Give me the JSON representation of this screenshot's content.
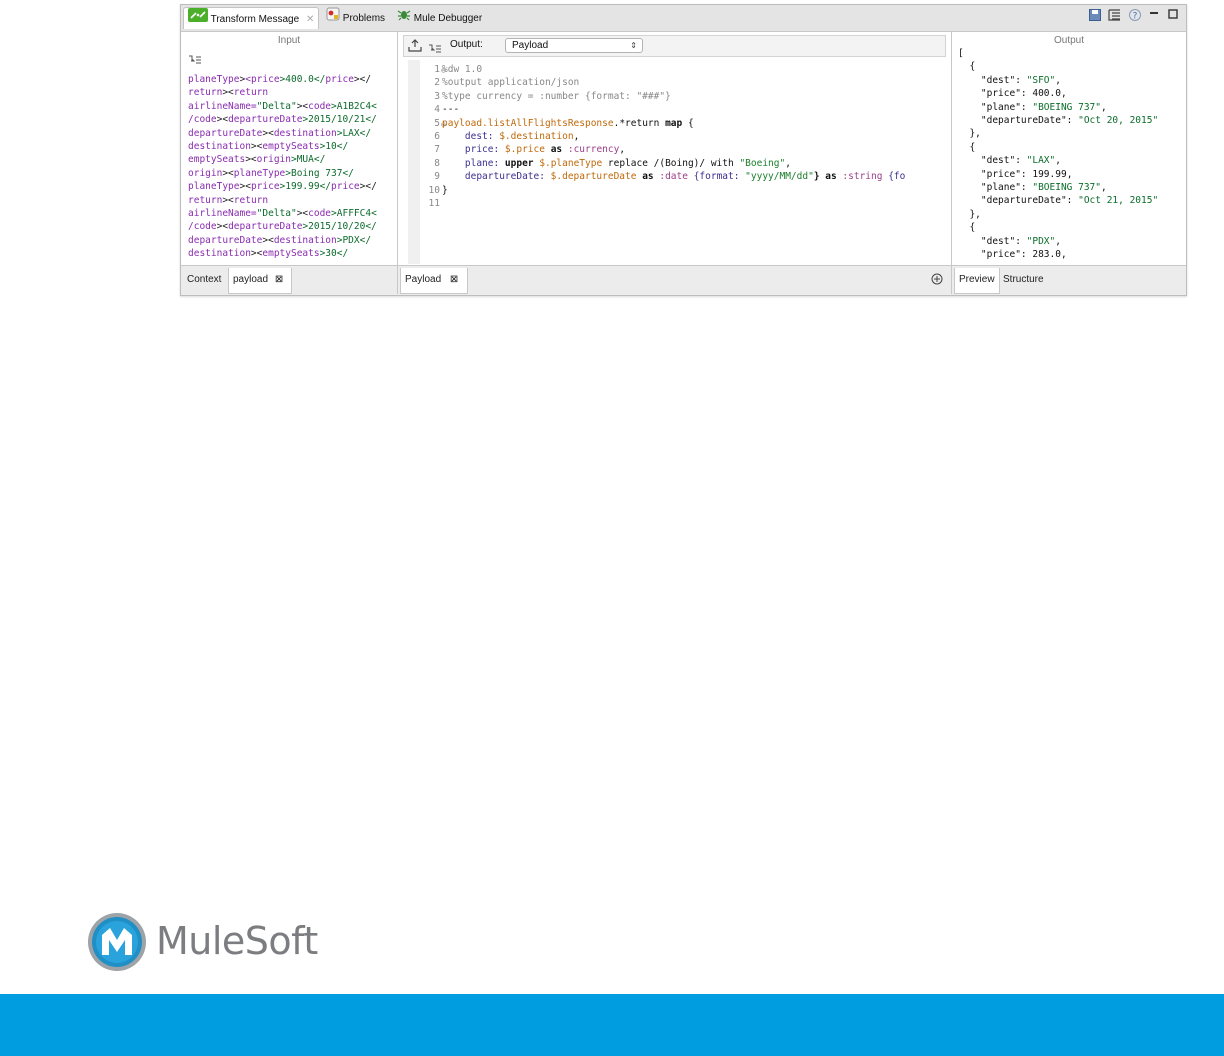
{
  "window_tabs": [
    {
      "label": "Transform Message",
      "icon": "transform-icon",
      "active": true
    },
    {
      "label": "Problems",
      "icon": "problems-icon",
      "active": false
    },
    {
      "label": "Mule Debugger",
      "icon": "debugger-icon",
      "active": false
    }
  ],
  "input_pane": {
    "title": "Input",
    "bottom_tabs": [
      "Context",
      "payload"
    ],
    "lines": [
      [
        {
          "t": "planeType",
          "c": "tg"
        },
        {
          "t": ">",
          "c": "ch"
        },
        {
          "t": "<price",
          "c": "tg"
        },
        {
          "t": ">400.0</",
          "c": "tx"
        },
        {
          "t": "price",
          "c": "tg"
        },
        {
          "t": "></",
          "c": "ch"
        }
      ],
      [
        {
          "t": "return",
          "c": "tg"
        },
        {
          "t": "><",
          "c": "ch"
        },
        {
          "t": "return",
          "c": "tg"
        }
      ],
      [
        {
          "t": "airlineName=",
          "c": "tg"
        },
        {
          "t": "\"Delta\"",
          "c": "tx"
        },
        {
          "t": "><",
          "c": "ch"
        },
        {
          "t": "code",
          "c": "tg"
        },
        {
          "t": ">A1B2C4<",
          "c": "tx"
        }
      ],
      [
        {
          "t": "/code",
          "c": "tg"
        },
        {
          "t": "><",
          "c": "ch"
        },
        {
          "t": "departureDate",
          "c": "tg"
        },
        {
          "t": ">2015/10/21</",
          "c": "tx"
        }
      ],
      [
        {
          "t": "departureDate",
          "c": "tg"
        },
        {
          "t": "><",
          "c": "ch"
        },
        {
          "t": "destination",
          "c": "tg"
        },
        {
          "t": ">LAX</",
          "c": "tx"
        }
      ],
      [
        {
          "t": "destination",
          "c": "tg"
        },
        {
          "t": "><",
          "c": "ch"
        },
        {
          "t": "emptySeats",
          "c": "tg"
        },
        {
          "t": ">10</",
          "c": "tx"
        }
      ],
      [
        {
          "t": "emptySeats",
          "c": "tg"
        },
        {
          "t": "><",
          "c": "ch"
        },
        {
          "t": "origin",
          "c": "tg"
        },
        {
          "t": ">MUA</",
          "c": "tx"
        }
      ],
      [
        {
          "t": "origin",
          "c": "tg"
        },
        {
          "t": "><",
          "c": "ch"
        },
        {
          "t": "planeType",
          "c": "tg"
        },
        {
          "t": ">Boing 737</",
          "c": "tx"
        }
      ],
      [
        {
          "t": "planeType",
          "c": "tg"
        },
        {
          "t": "><",
          "c": "ch"
        },
        {
          "t": "price",
          "c": "tg"
        },
        {
          "t": ">199.99</",
          "c": "tx"
        },
        {
          "t": "price",
          "c": "tg"
        },
        {
          "t": "></",
          "c": "ch"
        }
      ],
      [
        {
          "t": "return",
          "c": "tg"
        },
        {
          "t": "><",
          "c": "ch"
        },
        {
          "t": "return",
          "c": "tg"
        }
      ],
      [
        {
          "t": "airlineName=",
          "c": "tg"
        },
        {
          "t": "\"Delta\"",
          "c": "tx"
        },
        {
          "t": "><",
          "c": "ch"
        },
        {
          "t": "code",
          "c": "tg"
        },
        {
          "t": ">AFFFC4<",
          "c": "tx"
        }
      ],
      [
        {
          "t": "/code",
          "c": "tg"
        },
        {
          "t": "><",
          "c": "ch"
        },
        {
          "t": "departureDate",
          "c": "tg"
        },
        {
          "t": ">2015/10/20</",
          "c": "tx"
        }
      ],
      [
        {
          "t": "departureDate",
          "c": "tg"
        },
        {
          "t": "><",
          "c": "ch"
        },
        {
          "t": "destination",
          "c": "tg"
        },
        {
          "t": ">PDX</",
          "c": "tx"
        }
      ],
      [
        {
          "t": "destination",
          "c": "tg"
        },
        {
          "t": "><",
          "c": "ch"
        },
        {
          "t": "emptySeats",
          "c": "tg"
        },
        {
          "t": ">30</",
          "c": "tx"
        }
      ]
    ]
  },
  "script_pane": {
    "output_label": "Output:",
    "output_value": "Payload",
    "bottom_tab": "Payload",
    "lines": [
      {
        "n": "1",
        "fold": true,
        "parts": [
          {
            "t": "%dw 1.0",
            "c": "k-dir"
          }
        ]
      },
      {
        "n": "2",
        "parts": [
          {
            "t": "%output application/json",
            "c": "k-dir"
          }
        ]
      },
      {
        "n": "3",
        "parts": [
          {
            "t": "%type currency = :number {format: \"###\"}",
            "c": "k-dir"
          }
        ]
      },
      {
        "n": "4",
        "parts": [
          {
            "t": "---",
            "c": "k-plain"
          }
        ]
      },
      {
        "n": "5",
        "fold": true,
        "parts": [
          {
            "t": "payload.listAllFlightsResponse",
            "c": "k-sel"
          },
          {
            "t": ".*return ",
            "c": "k-plain"
          },
          {
            "t": "map",
            "c": "k-kw"
          },
          {
            "t": " {",
            "c": "k-plain"
          }
        ]
      },
      {
        "n": "6",
        "parts": [
          {
            "t": "    dest: ",
            "c": "k-id"
          },
          {
            "t": "$.destination",
            "c": "k-sel"
          },
          {
            "t": ",",
            "c": "k-plain"
          }
        ]
      },
      {
        "n": "7",
        "parts": [
          {
            "t": "    price: ",
            "c": "k-id"
          },
          {
            "t": "$.price",
            "c": "k-sel"
          },
          {
            "t": " as ",
            "c": "k-kw"
          },
          {
            "t": ":currency",
            "c": "k-typ"
          },
          {
            "t": ",",
            "c": "k-plain"
          }
        ]
      },
      {
        "n": "8",
        "parts": [
          {
            "t": "    plane: ",
            "c": "k-id"
          },
          {
            "t": "upper ",
            "c": "k-kw"
          },
          {
            "t": "$.planeType",
            "c": "k-sel"
          },
          {
            "t": " replace /(Boing)/ with ",
            "c": "k-plain"
          },
          {
            "t": "\"Boeing\"",
            "c": "k-str"
          },
          {
            "t": ",",
            "c": "k-plain"
          }
        ]
      },
      {
        "n": "9",
        "parts": [
          {
            "t": "    departureDate: ",
            "c": "k-id"
          },
          {
            "t": "$.departureDate",
            "c": "k-sel"
          },
          {
            "t": " as ",
            "c": "k-kw"
          },
          {
            "t": ":date ",
            "c": "k-typ"
          },
          {
            "t": "{format: ",
            "c": "k-id"
          },
          {
            "t": "\"yyyy/MM/dd\"",
            "c": "k-str"
          },
          {
            "t": "} as ",
            "c": "k-kw"
          },
          {
            "t": ":string ",
            "c": "k-typ"
          },
          {
            "t": "{fo",
            "c": "k-id"
          }
        ]
      },
      {
        "n": "10",
        "parts": [
          {
            "t": "}",
            "c": "k-plain"
          }
        ]
      },
      {
        "n": "11",
        "parts": []
      }
    ]
  },
  "output_pane": {
    "title": "Output",
    "bottom_tabs": [
      "Preview",
      "Structure"
    ],
    "lines": [
      [
        {
          "t": "[",
          "c": "key"
        }
      ],
      [
        {
          "t": "  {",
          "c": "key"
        }
      ],
      [
        {
          "t": "    \"dest\": ",
          "c": "key"
        },
        {
          "t": "\"SFO\"",
          "c": "sv"
        },
        {
          "t": ",",
          "c": "key"
        }
      ],
      [
        {
          "t": "    \"price\": ",
          "c": "key"
        },
        {
          "t": "400.0",
          "c": "nv"
        },
        {
          "t": ",",
          "c": "key"
        }
      ],
      [
        {
          "t": "    \"plane\": ",
          "c": "key"
        },
        {
          "t": "\"BOEING 737\"",
          "c": "sv"
        },
        {
          "t": ",",
          "c": "key"
        }
      ],
      [
        {
          "t": "    \"departureDate\": ",
          "c": "key"
        },
        {
          "t": "\"Oct 20, 2015\"",
          "c": "sv"
        }
      ],
      [
        {
          "t": "  },",
          "c": "key"
        }
      ],
      [
        {
          "t": "  {",
          "c": "key"
        }
      ],
      [
        {
          "t": "    \"dest\": ",
          "c": "key"
        },
        {
          "t": "\"LAX\"",
          "c": "sv"
        },
        {
          "t": ",",
          "c": "key"
        }
      ],
      [
        {
          "t": "    \"price\": ",
          "c": "key"
        },
        {
          "t": "199.99",
          "c": "nv"
        },
        {
          "t": ",",
          "c": "key"
        }
      ],
      [
        {
          "t": "    \"plane\": ",
          "c": "key"
        },
        {
          "t": "\"BOEING 737\"",
          "c": "sv"
        },
        {
          "t": ",",
          "c": "key"
        }
      ],
      [
        {
          "t": "    \"departureDate\": ",
          "c": "key"
        },
        {
          "t": "\"Oct 21, 2015\"",
          "c": "sv"
        }
      ],
      [
        {
          "t": "  },",
          "c": "key"
        }
      ],
      [
        {
          "t": "  {",
          "c": "key"
        }
      ],
      [
        {
          "t": "    \"dest\": ",
          "c": "key"
        },
        {
          "t": "\"PDX\"",
          "c": "sv"
        },
        {
          "t": ",",
          "c": "key"
        }
      ],
      [
        {
          "t": "    \"price\": ",
          "c": "key"
        },
        {
          "t": "283.0",
          "c": "nv"
        },
        {
          "t": ",",
          "c": "key"
        }
      ]
    ]
  },
  "brand": {
    "name": "MuleSoft",
    "accent": "#009ee0",
    "logo_blue": "#1f8fc6"
  }
}
